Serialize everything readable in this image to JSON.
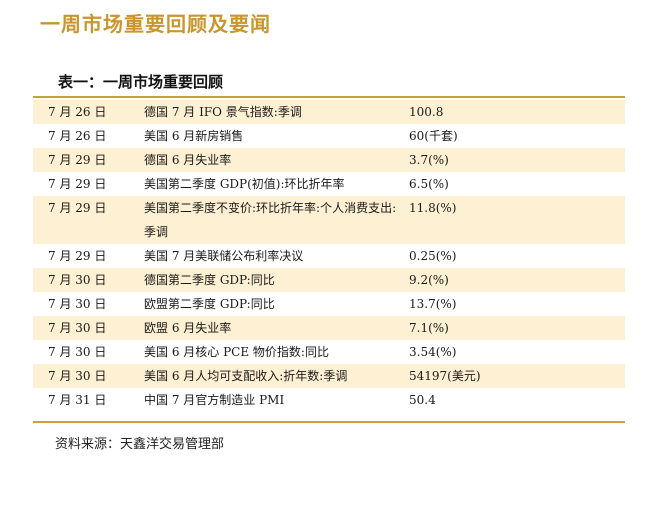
{
  "heading": "一周市场重要回顾及要闻",
  "table": {
    "title": "表一：一周市场重要回顾",
    "rows": [
      {
        "date": "7 月 26 日",
        "event": "德国 7 月 IFO 景气指数:季调",
        "value": "100.8",
        "shaded": true
      },
      {
        "date": "7 月 26 日",
        "event": "美国 6 月新房销售",
        "value": "60(千套)",
        "shaded": false
      },
      {
        "date": "7 月 29 日",
        "event": "德国 6 月失业率",
        "value": "3.7(%)",
        "shaded": true
      },
      {
        "date": "7 月 29 日",
        "event": "美国第二季度 GDP(初值):环比折年率",
        "value": "6.5(%)",
        "shaded": false
      },
      {
        "date": "7 月 29 日",
        "event": "美国第二季度不变价:环比折年率:个人消费支出:季调",
        "value": "11.8(%)",
        "shaded": true,
        "tall": true
      },
      {
        "date": "7 月 29 日",
        "event": "美国 7 月美联储公布利率决议",
        "value": "0.25(%)",
        "shaded": false
      },
      {
        "date": "7 月 30 日",
        "event": "德国第二季度 GDP:同比",
        "value": "9.2(%)",
        "shaded": true
      },
      {
        "date": "7 月 30 日",
        "event": "欧盟第二季度 GDP:同比",
        "value": "13.7(%)",
        "shaded": false
      },
      {
        "date": "7 月 30 日",
        "event": "欧盟 6 月失业率",
        "value": "7.1(%)",
        "shaded": true
      },
      {
        "date": "7 月 30 日",
        "event": "美国 6 月核心 PCE 物价指数:同比",
        "value": "3.54(%)",
        "shaded": false
      },
      {
        "date": "7 月 30 日",
        "event": "美国 6 月人均可支配收入:折年数:季调",
        "value": "54197(美元)",
        "shaded": true
      },
      {
        "date": "7 月 31 日",
        "event": "中国 7 月官方制造业 PMI",
        "value": "50.4",
        "shaded": false
      }
    ]
  },
  "source": "资料来源：天鑫洋交易管理部"
}
